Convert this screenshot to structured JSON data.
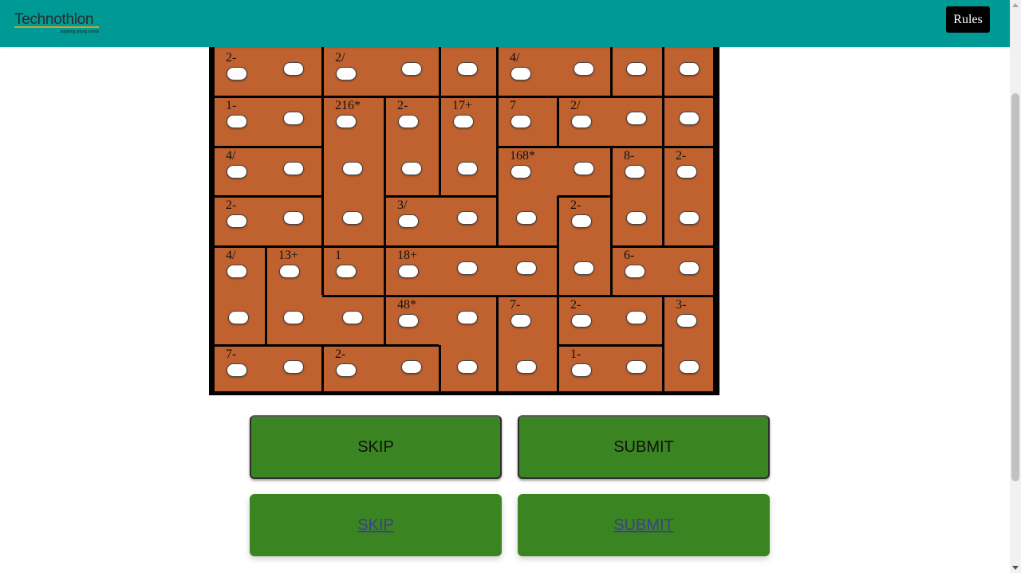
{
  "header": {
    "logo_title": "Technothlon",
    "logo_subtitle": "...inspiring young minds",
    "rules_label": "Rules"
  },
  "puzzle": {
    "cage_labels": [
      "2-",
      "2/",
      "4/",
      "1-",
      "216*",
      "2-",
      "17+",
      "7",
      "2/",
      "4/",
      "168*",
      "8-",
      "2-",
      "2-",
      "3/",
      "2-",
      "4/",
      "13+",
      "1",
      "18+",
      "6-",
      "48*",
      "7-",
      "2-",
      "3-",
      "7-",
      "2-",
      "1-"
    ]
  },
  "actions": {
    "skip_label": "SKIP",
    "submit_label": "SUBMIT",
    "skip_link_label": "SKIP",
    "submit_link_label": "SUBMIT"
  }
}
